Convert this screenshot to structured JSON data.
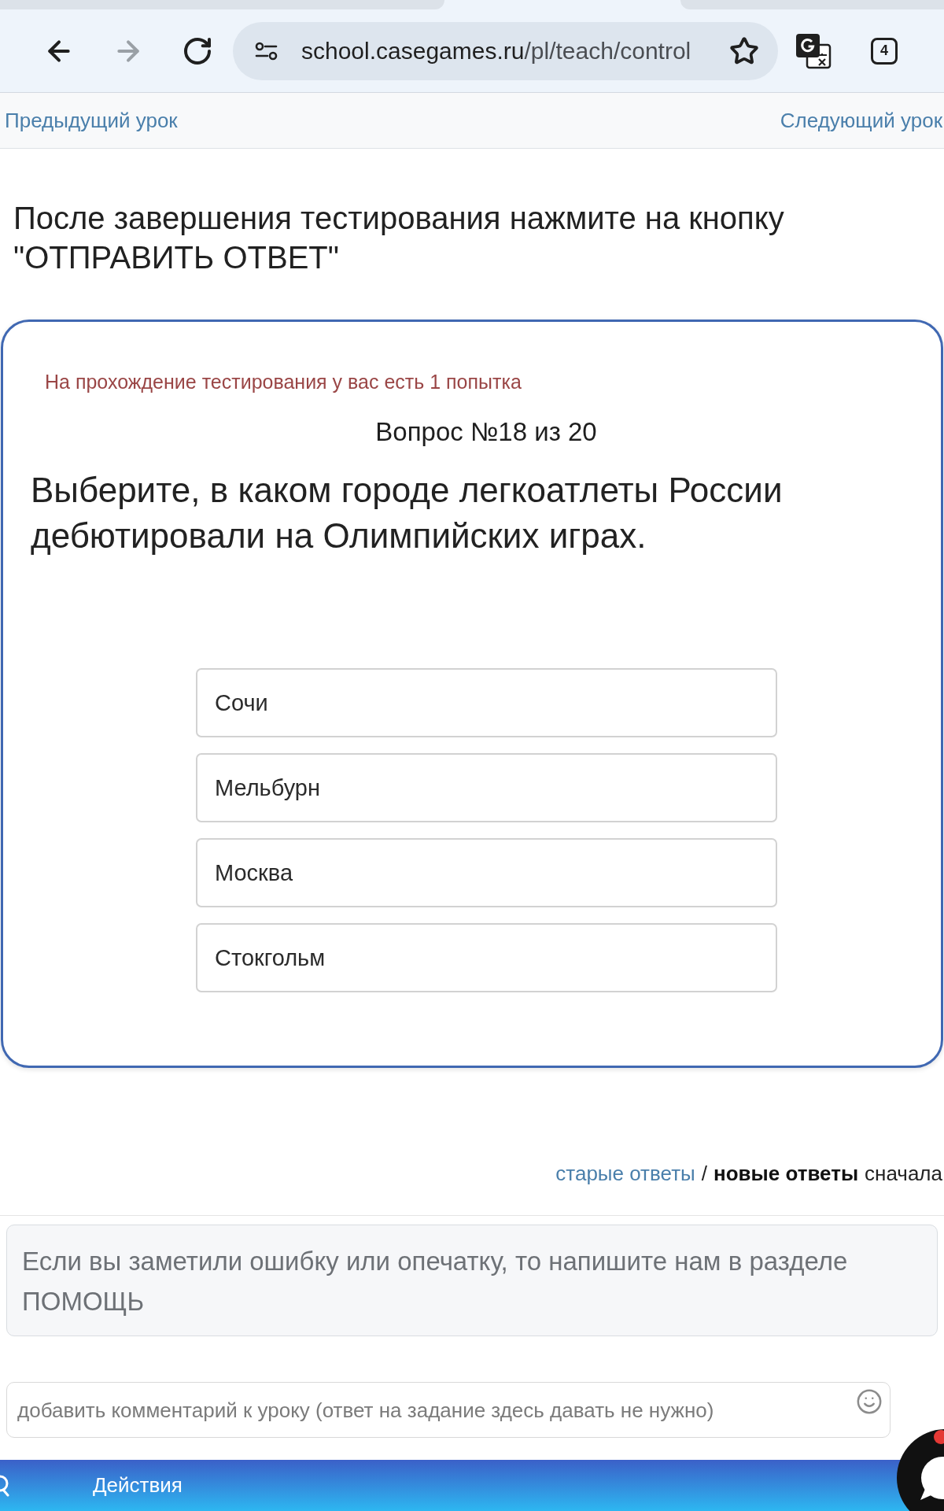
{
  "toolbar": {
    "nav_buttons": [
      {
        "kind": "back",
        "disabled": false
      },
      {
        "kind": "forward",
        "disabled": true
      },
      {
        "kind": "reload",
        "disabled": false
      }
    ],
    "url": {
      "host": "school.casegames.ru",
      "path": "/pl/teach/control"
    },
    "bookmarked": false,
    "tab_count": "4"
  },
  "lesson_nav": {
    "previous": "Предыдущий урок",
    "next": "Следующий урок"
  },
  "instruction": "После завершения тестирования нажмите на кнопку \"ОТПРАВИТЬ ОТВЕТ\"",
  "quiz": {
    "attempts_note": "На прохождение тестирования у вас есть 1 попытка",
    "question_number": "Вопрос №18 из 20",
    "question": "Выберите, в каком городе легкоатлеты России дебютировали на Олимпийских играх.",
    "options": [
      {
        "label": "Сочи",
        "selected": false
      },
      {
        "label": "Мельбурн",
        "selected": false
      },
      {
        "label": "Москва",
        "selected": false
      },
      {
        "label": "Стокгольм",
        "selected": false
      }
    ]
  },
  "answers_sort": {
    "options": [
      {
        "label": "старые ответы",
        "selected": false
      },
      {
        "label": "новые ответы",
        "selected": true
      }
    ],
    "separator": "/",
    "suffix": "сначала"
  },
  "notice": "Если вы заметили ошибку или опечатку, то напишите нам в разделе ПОМОЩЬ",
  "comment": {
    "placeholder": "добавить комментарий к уроку (ответ на задание здесь давать не нужно)"
  },
  "action_bar": {
    "label": "Действия"
  }
}
